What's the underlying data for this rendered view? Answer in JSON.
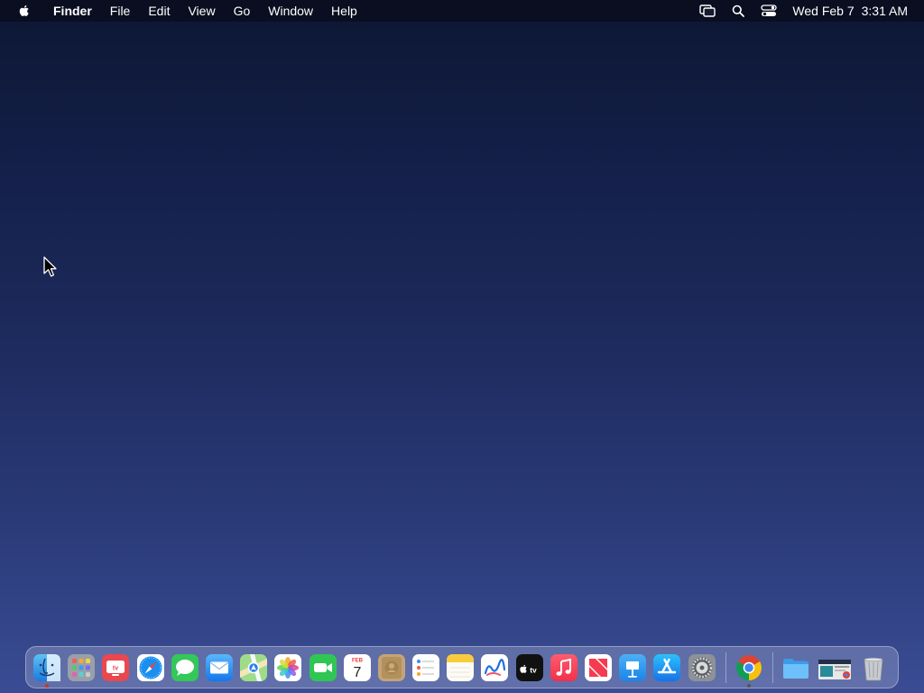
{
  "menubar": {
    "app_name": "Finder",
    "menus": [
      "File",
      "Edit",
      "View",
      "Go",
      "Window",
      "Help"
    ],
    "clock": {
      "date": "Wed Feb 7",
      "time": "3:31 AM"
    }
  },
  "dock": {
    "apps": [
      {
        "name": "Finder",
        "icon": "finder-icon",
        "running": true
      },
      {
        "name": "Launchpad",
        "icon": "launchpad-icon"
      },
      {
        "name": "TV",
        "icon": "tv-icon",
        "label": "tv"
      },
      {
        "name": "Safari",
        "icon": "safari-icon"
      },
      {
        "name": "Messages",
        "icon": "messages-icon"
      },
      {
        "name": "Mail",
        "icon": "mail-icon"
      },
      {
        "name": "Maps",
        "icon": "maps-icon"
      },
      {
        "name": "Photos",
        "icon": "photos-icon"
      },
      {
        "name": "FaceTime",
        "icon": "facetime-icon"
      },
      {
        "name": "Calendar",
        "icon": "calendar-icon",
        "month": "FEB",
        "day": "7"
      },
      {
        "name": "Contacts",
        "icon": "contacts-icon"
      },
      {
        "name": "Reminders",
        "icon": "reminders-icon"
      },
      {
        "name": "Notes",
        "icon": "notes-icon"
      },
      {
        "name": "Freeform",
        "icon": "freeform-icon"
      },
      {
        "name": "Apple TV",
        "icon": "appletv-icon",
        "label": "tv"
      },
      {
        "name": "Music",
        "icon": "music-icon"
      },
      {
        "name": "News",
        "icon": "news-icon"
      },
      {
        "name": "Keynote",
        "icon": "keynote-icon"
      },
      {
        "name": "App Store",
        "icon": "appstore-icon"
      },
      {
        "name": "System Settings",
        "icon": "settings-icon"
      },
      {
        "name": "Google Chrome",
        "icon": "chrome-icon",
        "running": true
      },
      {
        "name": "Downloads",
        "icon": "folder-icon"
      },
      {
        "name": "Recent Screenshot",
        "icon": "screenshot-thumbnail-icon"
      },
      {
        "name": "Trash",
        "icon": "trash-icon"
      }
    ]
  }
}
